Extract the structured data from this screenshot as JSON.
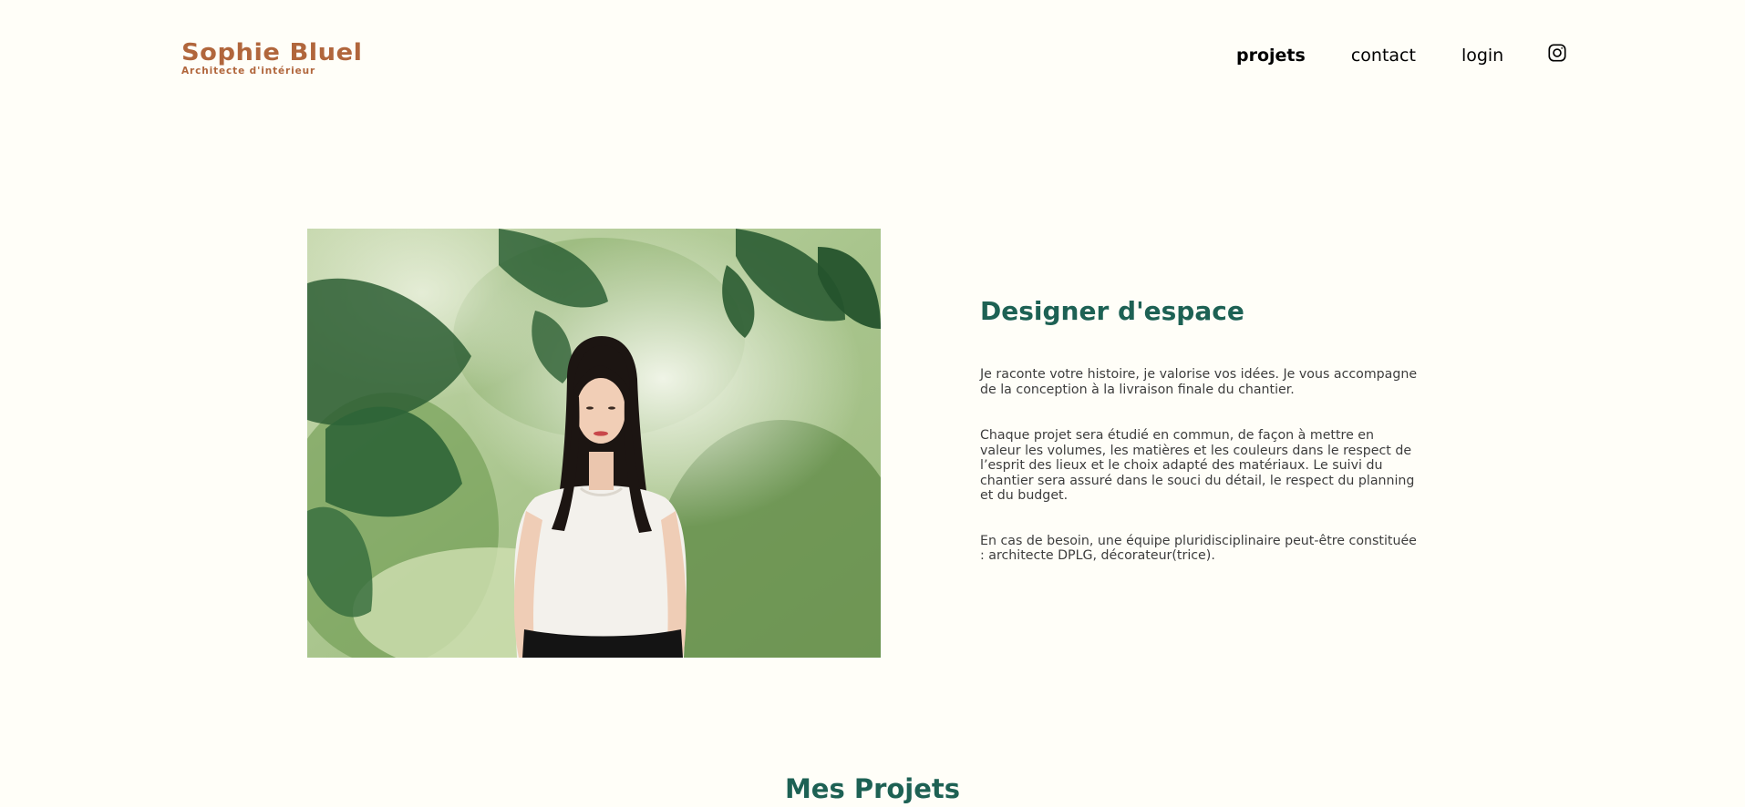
{
  "header": {
    "logo_title": "Sophie Bluel",
    "logo_subtitle": "Architecte d'intérieur",
    "nav": [
      {
        "label": "projets",
        "active": true
      },
      {
        "label": "contact",
        "active": false
      },
      {
        "label": "login",
        "active": false
      }
    ],
    "social_icon": "instagram-icon"
  },
  "intro": {
    "title": "Designer d'espace",
    "paragraphs": [
      "Je raconte votre histoire, je valorise vos idées. Je vous accompagne de la conception à la livraison finale du chantier.",
      "Chaque projet sera étudié en commun, de façon à mettre en valeur les volumes, les matières et les couleurs dans le respect de l’esprit des lieux et le choix adapté des matériaux. Le suivi du chantier sera assuré dans le souci du détail, le respect du planning et du budget.",
      "En cas de besoin, une équipe pluridisciplinaire peut-être constituée : architecte DPLG, décorateur(trice)."
    ]
  },
  "projects": {
    "title": "Mes Projets"
  },
  "colors": {
    "background": "#FFFEF8",
    "brand": "#B1663C",
    "accent": "#1D6154",
    "text": "#3D3D3D"
  }
}
